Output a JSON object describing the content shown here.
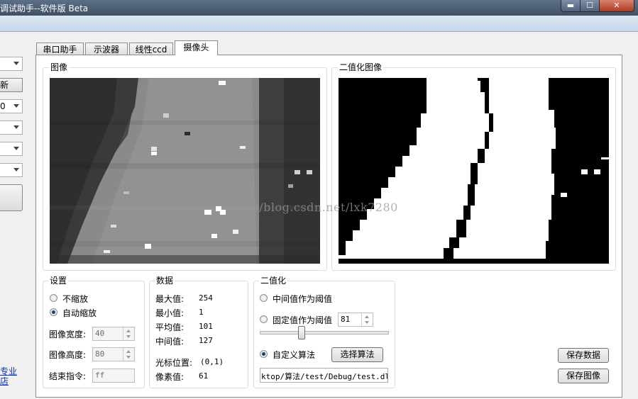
{
  "window": {
    "title": "调试助手--软件版 Beta",
    "minimize_glyph": "▬",
    "maximize_glyph": "☐",
    "close_glyph": "✕"
  },
  "left_panel": {
    "combo_values": [
      "",
      "",
      "0",
      "",
      "",
      ""
    ],
    "refresh_label": "新",
    "links": [
      "专业",
      "店"
    ]
  },
  "tabs": [
    {
      "label": "串口助手"
    },
    {
      "label": "示波器"
    },
    {
      "label": "线性ccd"
    },
    {
      "label": "摄像头",
      "active": true
    }
  ],
  "image_group": {
    "label": "图像"
  },
  "binary_group": {
    "label": "二值化图像"
  },
  "settings": {
    "label": "设置",
    "no_scale_label": "不缩放",
    "auto_scale_label": "自动缩放",
    "selected": "auto_scale",
    "width_label": "图像宽度:",
    "width_value": "40",
    "height_label": "图像高度:",
    "height_value": "80",
    "end_cmd_label": "结束指令:",
    "end_cmd_value": "ff"
  },
  "stats": {
    "label": "数据",
    "max_label": "最大值:",
    "max_value": "254",
    "min_label": "最小值:",
    "min_value": "1",
    "avg_label": "平均值:",
    "avg_value": "101",
    "mid_label": "中间值:",
    "mid_value": "127",
    "cursor_label": "光标位置:",
    "cursor_value": "(0,1)",
    "pixel_label": "像素值:",
    "pixel_value": "61"
  },
  "binarize": {
    "label": "二值化",
    "mid_threshold_label": "中间值作为阈值",
    "fixed_threshold_label": "固定值作为阈值",
    "fixed_threshold_value": "81",
    "slider_value": 81,
    "slider_max": 255,
    "custom_algo_label": "自定义算法",
    "select_algo_label": "选择算法",
    "dll_path": "ktop/算法/test/Debug/test.dll",
    "selected": "custom"
  },
  "actions": {
    "save_data_label": "保存数据",
    "save_image_label": "保存图像"
  },
  "watermark": "http://blog.csdn.net/lxk7280"
}
